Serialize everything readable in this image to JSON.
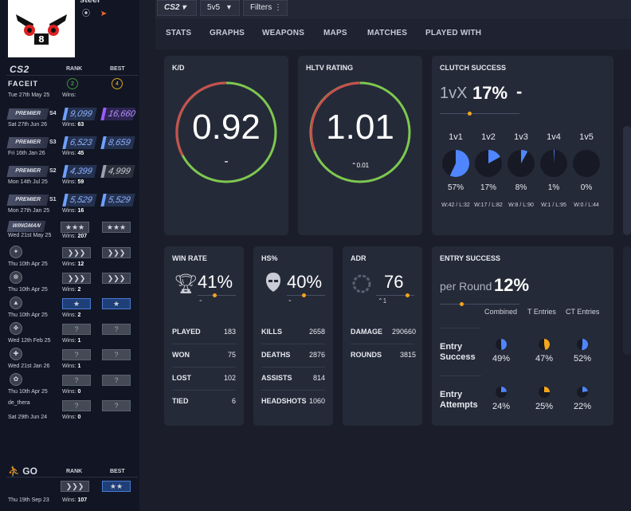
{
  "profile": {
    "title": "steel"
  },
  "cs2": {
    "logo": "CS2",
    "rank_header": "RANK",
    "best_header": "BEST",
    "faceit": {
      "label": "FACEIT",
      "date": "Tue 27th May 25",
      "wins_label": "Wins:",
      "rank_level": "2",
      "best_level": "4"
    },
    "premier": [
      {
        "label": "PREMIER",
        "season": "S4",
        "rating": "9,099",
        "best": "16,660",
        "best_color": "purple",
        "date": "Sat 27th Jun 26",
        "wins": "63"
      },
      {
        "label": "PREMIER",
        "season": "S3",
        "rating": "6,523",
        "best": "8,659",
        "best_color": "blue",
        "date": "Fri 16th Jan 26",
        "wins": "45"
      },
      {
        "label": "PREMIER",
        "season": "S2",
        "rating": "4,399",
        "best": "4,999",
        "best_color": "grey",
        "date": "Mon 14th Jul 25",
        "wins": "59"
      },
      {
        "label": "PREMIER",
        "season": "S1",
        "rating": "5,529",
        "best": "5,529",
        "best_color": "blue",
        "date": "Mon 27th Jan 25",
        "wins": "16"
      }
    ],
    "wingman": {
      "label": "WINGMAN",
      "date": "Wed 21st May 25",
      "wins": "207"
    },
    "maps": [
      {
        "date": "Thu 10th Apr 25",
        "wins": "12",
        "rank": "qm-none",
        "best": "qm-none"
      },
      {
        "date": "Thu 10th Apr 25",
        "wins": "2",
        "rank": "silver",
        "best": "silver"
      },
      {
        "date": "Thu 10th Apr 25",
        "wins": "2",
        "rank": "blue",
        "best": "blue"
      },
      {
        "date": "Wed 12th Feb 25",
        "wins": "1",
        "rank": "?",
        "best": "?"
      },
      {
        "date": "Wed 21st Jan 26",
        "wins": "1",
        "rank": "?",
        "best": "?"
      },
      {
        "date": "Thu 10th Apr 25",
        "wins": "0",
        "rank": "?",
        "best": "?"
      },
      {
        "name": "de_thera",
        "date": "Sat 29th Jun 24",
        "wins": "0",
        "rank": "?",
        "best": "?"
      }
    ]
  },
  "csgo": {
    "logo": "GO",
    "rank_header": "RANK",
    "best_header": "BEST",
    "date": "Thu 19th Sep 23",
    "wins": "107"
  },
  "toolbar": {
    "game_select": "CS2",
    "mode_select": "5v5",
    "filters": "Filters"
  },
  "tabs": [
    "STATS",
    "GRAPHS",
    "WEAPONS",
    "MAPS",
    "MATCHES",
    "PLAYED WITH"
  ],
  "kd": {
    "title": "K/D",
    "value": "0.92",
    "sub": "-"
  },
  "hltv": {
    "title": "HLTV RATING",
    "value": "1.01",
    "delta": "0.01"
  },
  "clutch": {
    "title": "CLUTCH SUCCESS",
    "prefix": "1vX",
    "value": "17%",
    "trend": "-",
    "items": [
      {
        "label": "1v1",
        "pct": "57%",
        "fraction": 0.57,
        "wl": "W:42 / L:32"
      },
      {
        "label": "1v2",
        "pct": "17%",
        "fraction": 0.17,
        "wl": "W:17 / L:82"
      },
      {
        "label": "1v3",
        "pct": "8%",
        "fraction": 0.08,
        "wl": "W:8 / L:90"
      },
      {
        "label": "1v4",
        "pct": "1%",
        "fraction": 0.01,
        "wl": "W:1 / L:95"
      },
      {
        "label": "1v5",
        "pct": "0%",
        "fraction": 0.0,
        "wl": "W:0 / L:44"
      }
    ]
  },
  "winrate": {
    "title": "WIN RATE",
    "value": "41%",
    "trend": "-",
    "rows": [
      {
        "label": "PLAYED",
        "value": "183"
      },
      {
        "label": "WON",
        "value": "75"
      },
      {
        "label": "LOST",
        "value": "102"
      },
      {
        "label": "TIED",
        "value": "6"
      }
    ]
  },
  "hs": {
    "title": "HS%",
    "value": "40%",
    "trend": "-",
    "rows": [
      {
        "label": "KILLS",
        "value": "2658"
      },
      {
        "label": "DEATHS",
        "value": "2876"
      },
      {
        "label": "ASSISTS",
        "value": "814"
      },
      {
        "label": "HEADSHOTS",
        "value": "1060"
      }
    ]
  },
  "adr": {
    "title": "ADR",
    "value": "76",
    "delta": "1",
    "rows": [
      {
        "label": "DAMAGE",
        "value": "290660"
      },
      {
        "label": "ROUNDS",
        "value": "3815"
      }
    ]
  },
  "entry": {
    "title": "ENTRY SUCCESS",
    "prefix": "per Round",
    "value": "12%",
    "columns": [
      "Combined",
      "T Entries",
      "CT Entries"
    ],
    "rows": [
      {
        "label": "Entry Success",
        "values": [
          "49%",
          "47%",
          "52%"
        ],
        "fractions": [
          0.49,
          0.47,
          0.52
        ]
      },
      {
        "label": "Entry Attempts",
        "values": [
          "24%",
          "25%",
          "22%"
        ],
        "fractions": [
          0.24,
          0.25,
          0.22
        ]
      }
    ]
  },
  "colors": {
    "blue": "#4f86ff",
    "orange": "#f4a51c",
    "red": "#c8504f",
    "green": "#7ec850",
    "bg": "#1b1e2a",
    "card": "#252a38"
  }
}
